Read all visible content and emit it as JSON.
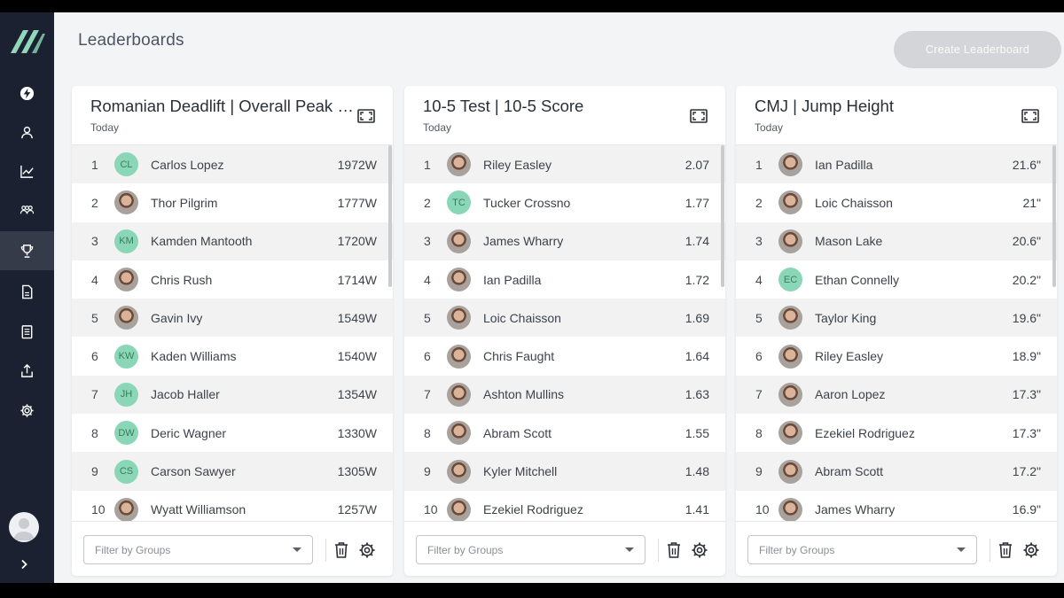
{
  "page": {
    "title": "Leaderboards",
    "create_button": "Create Leaderboard"
  },
  "colors": {
    "sidebar": "#1b2130",
    "active": "#353b48",
    "logo": "#8fd8b8",
    "initials_bg": "#8ad7b7"
  },
  "sidebar": {
    "items": [
      {
        "icon": "lightning-icon"
      },
      {
        "icon": "person-icon"
      },
      {
        "icon": "chart-icon"
      },
      {
        "icon": "group-icon"
      },
      {
        "icon": "trophy-icon",
        "active": true
      },
      {
        "icon": "document-icon"
      },
      {
        "icon": "clipboard-icon"
      },
      {
        "icon": "upload-icon"
      },
      {
        "icon": "gear-icon"
      }
    ]
  },
  "boards": [
    {
      "title": "Romanian Deadlift | Overall Peak Power",
      "subtitle": "Today",
      "filter_placeholder": "Filter by Groups",
      "rows": [
        {
          "rank": "1",
          "name": "Carlos Lopez",
          "value": "1972W",
          "initials": "CL"
        },
        {
          "rank": "2",
          "name": "Thor Pilgrim",
          "value": "1777W",
          "initials": ""
        },
        {
          "rank": "3",
          "name": "Kamden Mantooth",
          "value": "1720W",
          "initials": "KM"
        },
        {
          "rank": "4",
          "name": "Chris Rush",
          "value": "1714W",
          "initials": ""
        },
        {
          "rank": "5",
          "name": "Gavin Ivy",
          "value": "1549W",
          "initials": ""
        },
        {
          "rank": "6",
          "name": "Kaden Williams",
          "value": "1540W",
          "initials": "KW"
        },
        {
          "rank": "7",
          "name": "Jacob Haller",
          "value": "1354W",
          "initials": "JH"
        },
        {
          "rank": "8",
          "name": "Deric Wagner",
          "value": "1330W",
          "initials": "DW"
        },
        {
          "rank": "9",
          "name": "Carson Sawyer",
          "value": "1305W",
          "initials": "CS"
        },
        {
          "rank": "10",
          "name": "Wyatt Williamson",
          "value": "1257W",
          "initials": ""
        }
      ]
    },
    {
      "title": "10-5 Test | 10-5 Score",
      "subtitle": "Today",
      "filter_placeholder": "Filter by Groups",
      "rows": [
        {
          "rank": "1",
          "name": "Riley Easley",
          "value": "2.07",
          "initials": ""
        },
        {
          "rank": "2",
          "name": "Tucker Crossno",
          "value": "1.77",
          "initials": "TC"
        },
        {
          "rank": "3",
          "name": "James Wharry",
          "value": "1.74",
          "initials": ""
        },
        {
          "rank": "4",
          "name": "Ian Padilla",
          "value": "1.72",
          "initials": ""
        },
        {
          "rank": "5",
          "name": "Loic Chaisson",
          "value": "1.69",
          "initials": ""
        },
        {
          "rank": "6",
          "name": "Chris Faught",
          "value": "1.64",
          "initials": ""
        },
        {
          "rank": "7",
          "name": "Ashton Mullins",
          "value": "1.63",
          "initials": ""
        },
        {
          "rank": "8",
          "name": "Abram Scott",
          "value": "1.55",
          "initials": ""
        },
        {
          "rank": "9",
          "name": "Kyler Mitchell",
          "value": "1.48",
          "initials": ""
        },
        {
          "rank": "10",
          "name": "Ezekiel Rodriguez",
          "value": "1.41",
          "initials": ""
        }
      ]
    },
    {
      "title": "CMJ | Jump Height",
      "subtitle": "Today",
      "filter_placeholder": "Filter by Groups",
      "rows": [
        {
          "rank": "1",
          "name": "Ian Padilla",
          "value": "21.6\"",
          "initials": ""
        },
        {
          "rank": "2",
          "name": "Loic Chaisson",
          "value": "21\"",
          "initials": ""
        },
        {
          "rank": "3",
          "name": "Mason Lake",
          "value": "20.6\"",
          "initials": ""
        },
        {
          "rank": "4",
          "name": "Ethan Connelly",
          "value": "20.2\"",
          "initials": "EC"
        },
        {
          "rank": "5",
          "name": "Taylor King",
          "value": "19.6\"",
          "initials": ""
        },
        {
          "rank": "6",
          "name": "Riley Easley",
          "value": "18.9\"",
          "initials": ""
        },
        {
          "rank": "7",
          "name": "Aaron Lopez",
          "value": "17.3\"",
          "initials": ""
        },
        {
          "rank": "8",
          "name": "Ezekiel Rodriguez",
          "value": "17.3\"",
          "initials": ""
        },
        {
          "rank": "9",
          "name": "Abram Scott",
          "value": "17.2\"",
          "initials": ""
        },
        {
          "rank": "10",
          "name": "James Wharry",
          "value": "16.9\"",
          "initials": ""
        }
      ]
    }
  ]
}
